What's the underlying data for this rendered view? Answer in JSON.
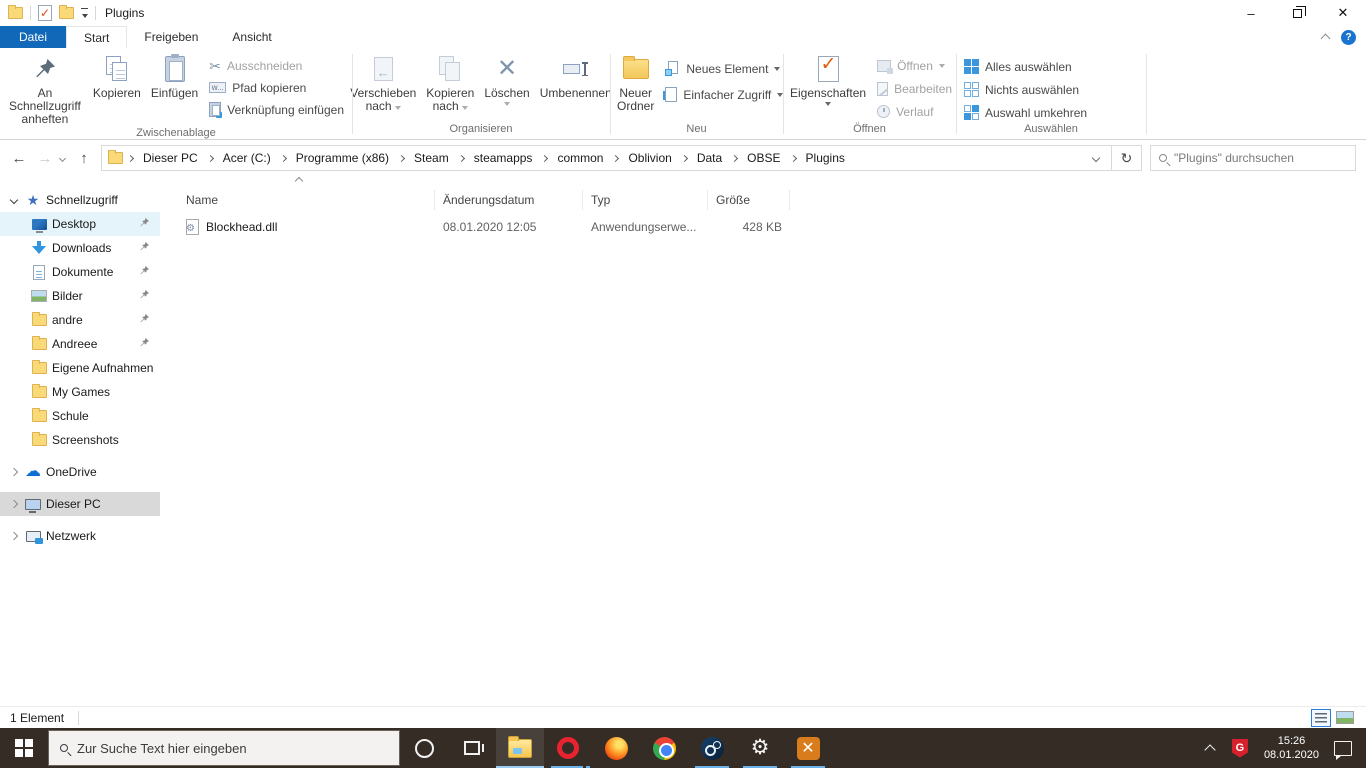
{
  "titlebar": {
    "title": "Plugins"
  },
  "menu_tabs": {
    "file": "Datei",
    "start": "Start",
    "share": "Freigeben",
    "view": "Ansicht"
  },
  "ribbon": {
    "pin_quick_access": "An Schnellzugriff anheften",
    "copy": "Kopieren",
    "paste": "Einfügen",
    "cut": "Ausschneiden",
    "copy_path": "Pfad kopieren",
    "paste_shortcut": "Verknüpfung einfügen",
    "group_clipboard": "Zwischenablage",
    "move_to": "Verschieben nach",
    "copy_to": "Kopieren nach",
    "delete": "Löschen",
    "rename": "Umbenennen",
    "group_organize": "Organisieren",
    "new_folder_line1": "Neuer",
    "new_folder_line2": "Ordner",
    "new_item": "Neues Element",
    "easy_access": "Einfacher Zugriff",
    "group_new": "Neu",
    "properties": "Eigenschaften",
    "open": "Öffnen",
    "edit": "Bearbeiten",
    "history": "Verlauf",
    "group_open": "Öffnen",
    "select_all": "Alles auswählen",
    "select_none": "Nichts auswählen",
    "invert_selection": "Auswahl umkehren",
    "group_select": "Auswählen"
  },
  "address": {
    "breadcrumbs": [
      "Dieser PC",
      "Acer (C:)",
      "Programme (x86)",
      "Steam",
      "steamapps",
      "common",
      "Oblivion",
      "Data",
      "OBSE",
      "Plugins"
    ],
    "search_placeholder": "\"Plugins\" durchsuchen"
  },
  "sidebar": {
    "quick_access": "Schnellzugriff",
    "items": [
      "Desktop",
      "Downloads",
      "Dokumente",
      "Bilder",
      "andre",
      "Andreee",
      "Eigene Aufnahmen",
      "My Games",
      "Schule",
      "Screenshots"
    ],
    "onedrive": "OneDrive",
    "this_pc": "Dieser PC",
    "network": "Netzwerk"
  },
  "files": {
    "col_name": "Name",
    "col_date": "Änderungsdatum",
    "col_type": "Typ",
    "col_size": "Größe",
    "rows": [
      {
        "name": "Blockhead.dll",
        "date": "08.01.2020 12:05",
        "type": "Anwendungserwe...",
        "size": "428 KB"
      }
    ]
  },
  "status": {
    "count": "1 Element"
  },
  "taskbar": {
    "search_placeholder": "Zur Suche Text hier eingeben",
    "time": "15:26",
    "date": "08.01.2020"
  },
  "icons": {
    "cut": "✂",
    "delete_x": "✕",
    "back": "←",
    "forward": "→",
    "up": "↑",
    "refresh": "↻",
    "star": "★",
    "cloud": "☁",
    "gear": "⚙",
    "minimize": "–",
    "close": "✕",
    "obse_x": "✕",
    "help": "?"
  },
  "colors": {
    "accent_blue": "#1168b8",
    "selection_blue": "#3a96dd",
    "taskbar_bg": "#352c26",
    "underline_blue": "#6cb2e8",
    "folder_yellow": "#f7c64e",
    "check_orange": "#e8590c"
  }
}
